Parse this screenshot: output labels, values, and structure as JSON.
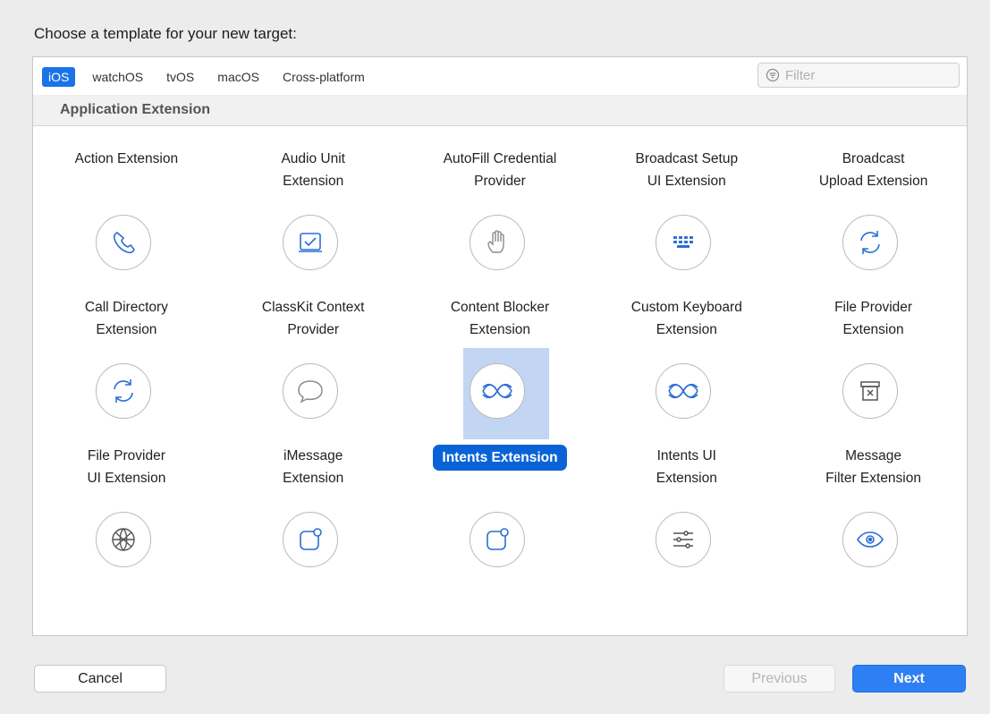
{
  "prompt": "Choose a template for your new target:",
  "tabs": [
    "iOS",
    "watchOS",
    "tvOS",
    "macOS",
    "Cross-platform"
  ],
  "active_tab": "iOS",
  "filter": {
    "placeholder": "Filter",
    "value": ""
  },
  "section_title": "Application Extension",
  "templates": [
    {
      "label": "Action Extension",
      "icon": "gear-icon"
    },
    {
      "label": "Audio Unit\nExtension",
      "icon": "audio-waves-icon"
    },
    {
      "label": "AutoFill Credential\nProvider",
      "icon": "password-dots-icon"
    },
    {
      "label": "Broadcast Setup\nUI Extension",
      "icon": "layers-icon"
    },
    {
      "label": "Broadcast\nUpload Extension",
      "icon": "layers-icon"
    },
    {
      "label": "Call Directory\nExtension",
      "icon": "phone-icon"
    },
    {
      "label": "ClassKit Context\nProvider",
      "icon": "checkbox-tray-icon"
    },
    {
      "label": "Content Blocker\nExtension",
      "icon": "hand-icon"
    },
    {
      "label": "Custom Keyboard\nExtension",
      "icon": "keyboard-icon"
    },
    {
      "label": "File Provider\nExtension",
      "icon": "sync-arrows-icon"
    },
    {
      "label": "File Provider\nUI Extension",
      "icon": "sync-arrows-icon"
    },
    {
      "label": "iMessage\nExtension",
      "icon": "speech-bubble-icon"
    },
    {
      "label": "Intents Extension",
      "icon": "intents-waves-icon",
      "selected": true
    },
    {
      "label": "Intents UI\nExtension",
      "icon": "intents-waves-icon"
    },
    {
      "label": "Message\nFilter Extension",
      "icon": "archive-box-icon"
    },
    {
      "label": "",
      "icon": "globe-icon"
    },
    {
      "label": "",
      "icon": "rounded-square-dot-icon"
    },
    {
      "label": "",
      "icon": "rounded-square-dot-icon"
    },
    {
      "label": "",
      "icon": "sliders-icon"
    },
    {
      "label": "",
      "icon": "eye-icon"
    }
  ],
  "buttons": {
    "cancel": "Cancel",
    "previous": "Previous",
    "next": "Next"
  },
  "colors": {
    "accent": "#1a74e8",
    "selection_bg": "#c2d6f3",
    "selected_label": "#0a63d6",
    "next_button": "#2f7ff4"
  }
}
